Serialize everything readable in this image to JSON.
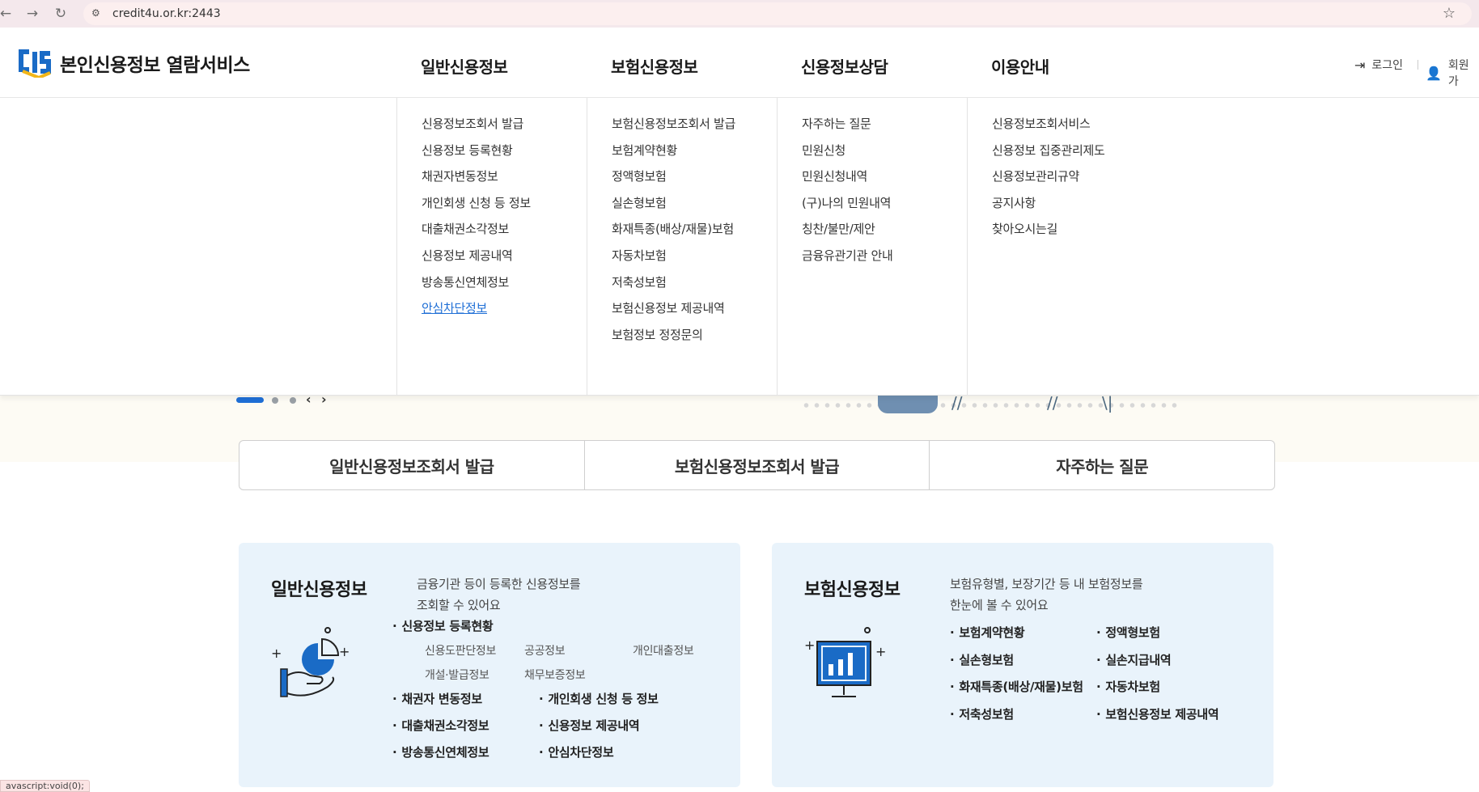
{
  "browser": {
    "url": "credit4u.or.kr:2443"
  },
  "header": {
    "site_title": "본인신용정보 열람서비스",
    "nav": [
      "일반신용정보",
      "보험신용정보",
      "신용정보상담",
      "이용안내"
    ],
    "login": "로그인",
    "join": "회원가"
  },
  "mega": {
    "col1": [
      "신용정보조회서 발급",
      "신용정보 등록현황",
      "채권자변동정보",
      "개인회생 신청 등 정보",
      "대출채권소각정보",
      "신용정보 제공내역",
      "방송통신연체정보",
      "안심차단정보"
    ],
    "col2": [
      "보험신용정보조회서 발급",
      "보험계약현황",
      "정액형보험",
      "실손형보험",
      "화재특종(배상/재물)보험",
      "자동차보험",
      "저축성보험",
      "보험신용정보 제공내역",
      "보험정보 정정문의"
    ],
    "col3": [
      "자주하는 질문",
      "민원신청",
      "민원신청내역",
      "(구)나의 민원내역",
      "칭찬/불만/제안",
      "금융유관기관 안내"
    ],
    "col4": [
      "신용정보조회서비스",
      "신용정보 집중관리제도",
      "신용정보관리규약",
      "공지사항",
      "찾아오시는길"
    ]
  },
  "quick": [
    "일반신용정보조회서 발급",
    "보험신용정보조회서 발급",
    "자주하는 질문"
  ],
  "card_general": {
    "title": "일반신용정보",
    "desc1": "금융기관 등이 등록한 신용정보를",
    "desc2": "조회할 수 있어요",
    "b_register": "신용정보 등록현황",
    "subs": [
      "신용도판단정보",
      "공공정보",
      "개인대출정보",
      "개설·발급정보",
      "채무보증정보"
    ],
    "bullets": [
      "채권자 변동정보",
      "개인회생 신청 등 정보",
      "대출채권소각정보",
      "신용정보 제공내역",
      "방송통신연체정보",
      "안심차단정보"
    ]
  },
  "card_insurance": {
    "title": "보험신용정보",
    "desc1": "보험유형별, 보장기간 등 내 보험정보를",
    "desc2": "한눈에 볼 수 있어요",
    "bullets": [
      "보험계약현황",
      "정액형보험",
      "실손형보험",
      "실손지급내역",
      "화재특종(배상/재물)보험",
      "자동차보험",
      "저축성보험",
      "보험신용정보 제공내역"
    ]
  },
  "status": "avascript:void(0);",
  "colors": {
    "accent": "#1f6fd6",
    "card_bg": "#e9f3fb",
    "icon_blue": "#1a6bc6"
  }
}
